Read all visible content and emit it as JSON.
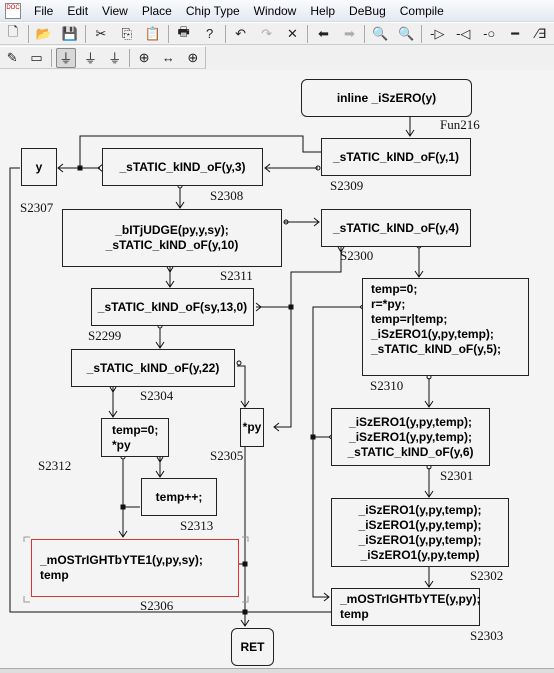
{
  "menu": {
    "items": [
      "File",
      "Edit",
      "View",
      "Place",
      "Chip Type",
      "Window",
      "Help",
      "DeBug",
      "Compile"
    ]
  },
  "toolbar1": [
    {
      "icon": "new-file-icon",
      "glyph": "🗋"
    },
    {
      "icon": "open-folder-icon",
      "glyph": "📂"
    },
    {
      "icon": "save-icon",
      "glyph": "💾"
    },
    {
      "icon": "cut-icon",
      "glyph": "✂"
    },
    {
      "icon": "copy-icon",
      "glyph": "⎘"
    },
    {
      "icon": "paste-icon",
      "glyph": "📋"
    },
    {
      "icon": "print-icon",
      "glyph": "🖶"
    },
    {
      "icon": "help-icon",
      "glyph": "?"
    },
    {
      "icon": "undo-icon",
      "glyph": "↶"
    },
    {
      "icon": "redo-icon",
      "glyph": "↷"
    },
    {
      "icon": "delete-icon",
      "glyph": "✕"
    },
    {
      "icon": "back-arrow-icon",
      "glyph": "⬅"
    },
    {
      "icon": "forward-arrow-icon",
      "glyph": "➡"
    },
    {
      "icon": "zoom-icon",
      "glyph": "🔍"
    },
    {
      "icon": "zoom-in-icon",
      "glyph": "🔍"
    },
    {
      "icon": "input-pin-icon",
      "glyph": "-▷"
    },
    {
      "icon": "output-pin-icon",
      "glyph": "-◁"
    },
    {
      "icon": "circle-pin-icon",
      "glyph": "-○"
    },
    {
      "icon": "line-icon",
      "glyph": "━"
    },
    {
      "icon": "bus-icon",
      "glyph": "⁄∃"
    }
  ],
  "toolbar2": [
    {
      "icon": "pen-icon",
      "glyph": "✎"
    },
    {
      "icon": "rectangle-icon",
      "glyph": "▭"
    },
    {
      "icon": "chip-icon",
      "glyph": "⏚"
    },
    {
      "icon": "chip-in-icon",
      "glyph": "⏚"
    },
    {
      "icon": "chip-dotted-icon",
      "glyph": "⏚"
    },
    {
      "icon": "align-icon",
      "glyph": "⊕"
    },
    {
      "icon": "h-spread-icon",
      "glyph": "↔"
    },
    {
      "icon": "center-icon",
      "glyph": "⊕"
    }
  ],
  "nodes": {
    "fun": {
      "text": [
        "inline _iSzERO(y)"
      ],
      "label": "Fun216"
    },
    "s2309": {
      "text": [
        "_sTATIC_kIND_oF(y,1)"
      ],
      "label": "S2309"
    },
    "y": {
      "text": [
        "y"
      ]
    },
    "s2308": {
      "text": [
        "_sTATIC_kIND_oF(y,3)"
      ],
      "label": "S2308"
    },
    "s2307": {
      "text": [
        "_bITjUDGE(py,y,sy);",
        "_sTATIC_kIND_oF(y,10)"
      ],
      "label": "S2307"
    },
    "s2300": {
      "text": [
        "_sTATIC_kIND_oF(y,4)"
      ],
      "label": "S2300"
    },
    "s2311": {
      "label": "S2311"
    },
    "s2310": {
      "text": [
        "temp=0;",
        "r=*py;",
        "temp=r|temp;",
        "_iSzERO1(y,py,temp);",
        "_sTATIC_kIND_oF(y,5);"
      ],
      "label": "S2310"
    },
    "s2299": {
      "text": [
        "_sTATIC_kIND_oF(sy,13,0)"
      ],
      "label": "S2299"
    },
    "s2304": {
      "text": [
        "_sTATIC_kIND_oF(y,22)"
      ],
      "label": "S2304"
    },
    "s2312": {
      "text": [
        "temp=0;",
        "*py"
      ],
      "label": "S2312"
    },
    "s2305": {
      "text": [
        "*py"
      ],
      "label": "S2305"
    },
    "s2301": {
      "text": [
        "_iSzERO1(y,py,temp);",
        "_iSzERO1(y,py,temp);",
        "_sTATIC_kIND_oF(y,6)"
      ],
      "label": "S2301"
    },
    "s2313": {
      "text": [
        "temp++;"
      ],
      "label": "S2313"
    },
    "s2302": {
      "text": [
        "_iSzERO1(y,py,temp);",
        "_iSzERO1(y,py,temp);",
        "_iSzERO1(y,py,temp);",
        "_iSzERO1(y,py,temp)"
      ],
      "label": "S2302"
    },
    "s2306": {
      "text": [
        "_mOSTrIGHTbYTE1(y,py,sy);",
        "temp"
      ],
      "label": "S2306"
    },
    "s2303": {
      "text": [
        "_mOSTrIGHTbYTE(y,py);",
        "temp"
      ],
      "label": "S2303"
    },
    "ret": {
      "text": [
        "RET"
      ]
    }
  },
  "colors": {
    "selected_border": "#d33",
    "menubar": "#e3e8f1"
  }
}
